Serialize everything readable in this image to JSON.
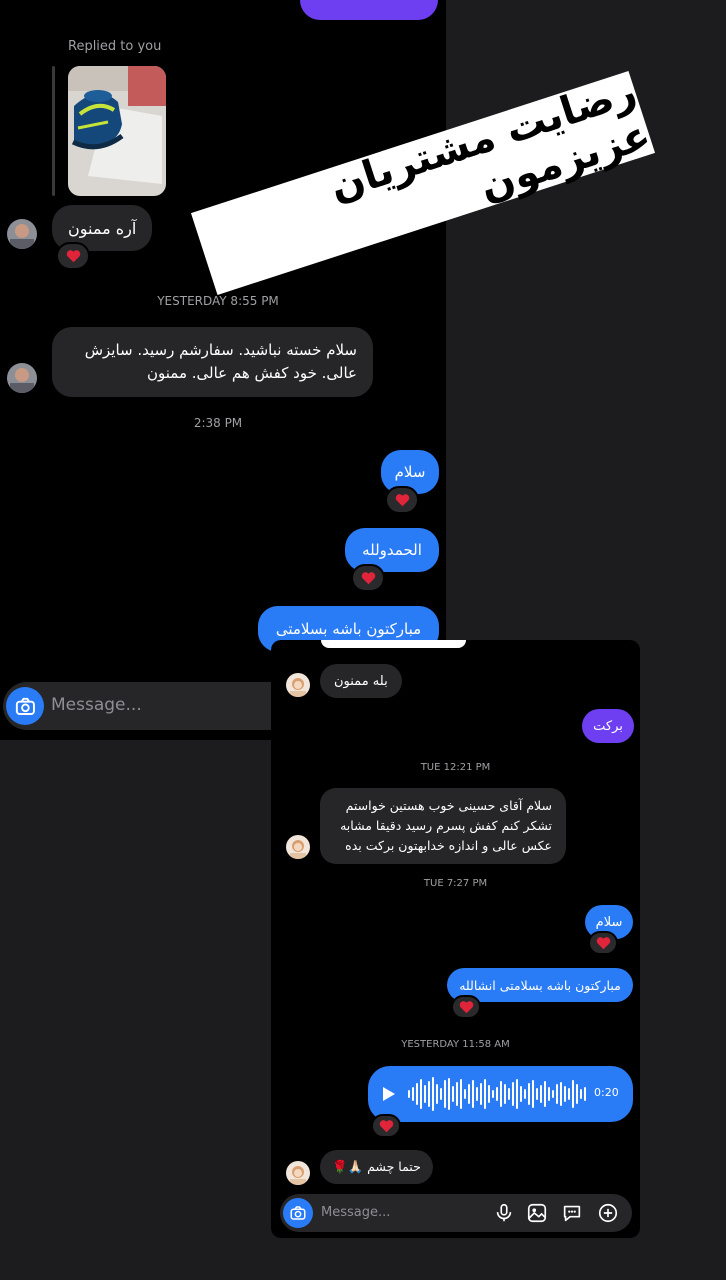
{
  "screen1": {
    "replied_label": "Replied to you",
    "msg_reply": "آره ممنون",
    "ts_yesterday": "YESTERDAY 8:55 PM",
    "msg_long": "سلام خسته نباشید. سفارشم رسید. سایزش عالی. خود کفش هم عالی. ممنون",
    "ts_today": "2:38 PM",
    "out_salam": "سلام",
    "out_alhamdulillah": "الحمدولله",
    "out_mobarak": "مبارکتون باشه بسلامتی",
    "composer_placeholder": "Message..."
  },
  "banner": {
    "text": "رضایت مشتریان عزیزمون"
  },
  "screen2": {
    "msg_bale": "بله ممنون",
    "out_barakat": "برکت",
    "ts_tue1": "TUE 12:21 PM",
    "msg_long": "سلام آقای حسینی خوب هستین خواستم تشکر کنم کفش پسرم رسید دقیقا مشابه عکس عالی و اندازه خدابهتون برکت بده",
    "ts_tue2": "TUE 7:27 PM",
    "out_salam": "سلام",
    "out_mobarak": "مبارکتون باشه بسلامتی انشالله",
    "ts_yesterday": "YESTERDAY 11:58 AM",
    "voice_duration": "0:20",
    "msg_hatman": "حتما چشم 🙏🏻🌹",
    "composer_placeholder": "Message..."
  },
  "colors": {
    "outgoing_blue": "#2a7cf6",
    "outgoing_purple": "#6d3ff0",
    "incoming_gray": "#262628",
    "heart_red": "#e0243a"
  },
  "icons": [
    "camera-icon",
    "heart-icon",
    "mic-icon",
    "gallery-icon",
    "sticker-icon",
    "plus-icon",
    "play-icon"
  ]
}
